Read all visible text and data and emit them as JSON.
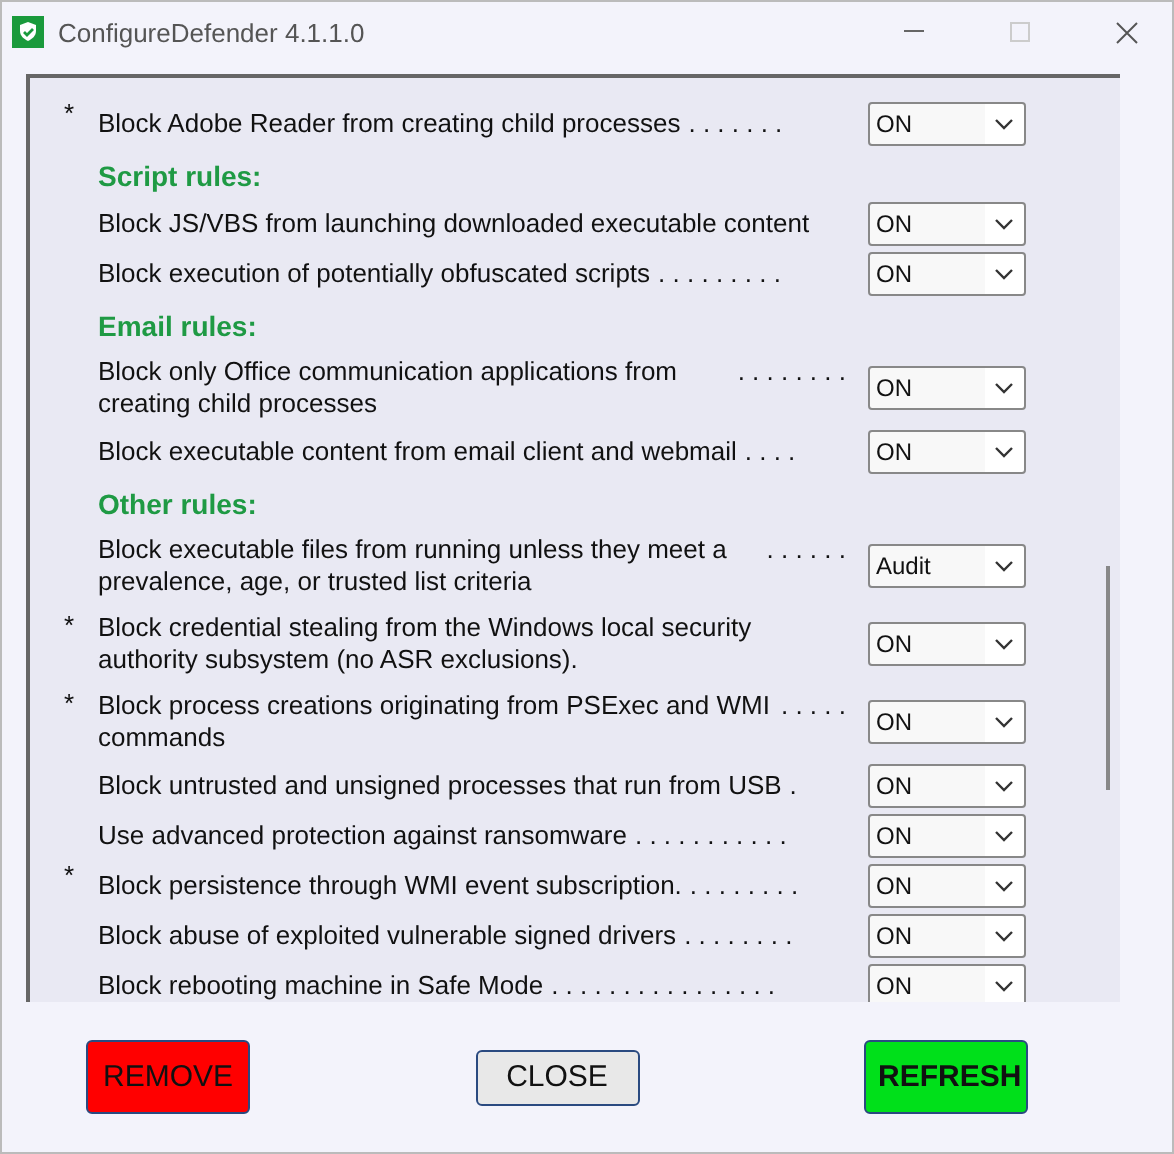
{
  "window": {
    "title": "ConfigureDefender 4.1.1.0"
  },
  "items": [
    {
      "kind": "rule",
      "marker": "*",
      "label": "Block Adobe Reader from creating child processes",
      "leader": ". . . . . . .",
      "value": "ON"
    },
    {
      "kind": "heading",
      "label": "Script rules:"
    },
    {
      "kind": "rule",
      "label": "Block JS/VBS from launching downloaded executable content",
      "value": "ON"
    },
    {
      "kind": "rule",
      "label": "Block execution of potentially obfuscated scripts",
      "leader": ". . . . . . . . .",
      "value": "ON"
    },
    {
      "kind": "heading",
      "label": "Email rules:"
    },
    {
      "kind": "rule",
      "label": "Block only Office communication applications from creating child processes",
      "leader": ". . . . . . . .",
      "value": "ON"
    },
    {
      "kind": "rule",
      "label": "Block executable content from email client and webmail",
      "leader": ". . . .",
      "value": "ON"
    },
    {
      "kind": "heading",
      "label": "Other rules:"
    },
    {
      "kind": "rule",
      "label": "Block executable files from running unless they meet a prevalence, age, or trusted list criteria",
      "leader": ". . . . . .",
      "value": "Audit"
    },
    {
      "kind": "rule",
      "marker": "*",
      "label": "Block credential stealing from the Windows local security authority subsystem (no ASR exclusions).",
      "value": "ON"
    },
    {
      "kind": "rule",
      "marker": "*",
      "label": "Block process creations originating from PSExec and WMI commands",
      "leader": ". . . . .",
      "value": "ON"
    },
    {
      "kind": "rule",
      "label": "Block untrusted and unsigned processes that run from USB",
      "leader": ".",
      "value": "ON"
    },
    {
      "kind": "rule",
      "label": "Use advanced protection against ransomware",
      "leader": ". . . . . . . . . . .",
      "value": "ON"
    },
    {
      "kind": "rule",
      "marker": "*",
      "label": "Block persistence through WMI event subscription.",
      "leader": ". . . . . . . .",
      "value": "ON"
    },
    {
      "kind": "rule",
      "label": "Block abuse of exploited vulnerable signed drivers",
      "leader": ". . . . . . . .",
      "value": "ON"
    },
    {
      "kind": "rule",
      "label": "Block rebooting machine in Safe Mode",
      "leader": ". . . . . . . . . . . . . . . .",
      "value": "ON"
    }
  ],
  "buttons": [
    {
      "kind": "remove",
      "label": "REMOVE"
    },
    {
      "kind": "close",
      "label": "CLOSE"
    },
    {
      "kind": "refresh",
      "label": "REFRESH"
    }
  ]
}
